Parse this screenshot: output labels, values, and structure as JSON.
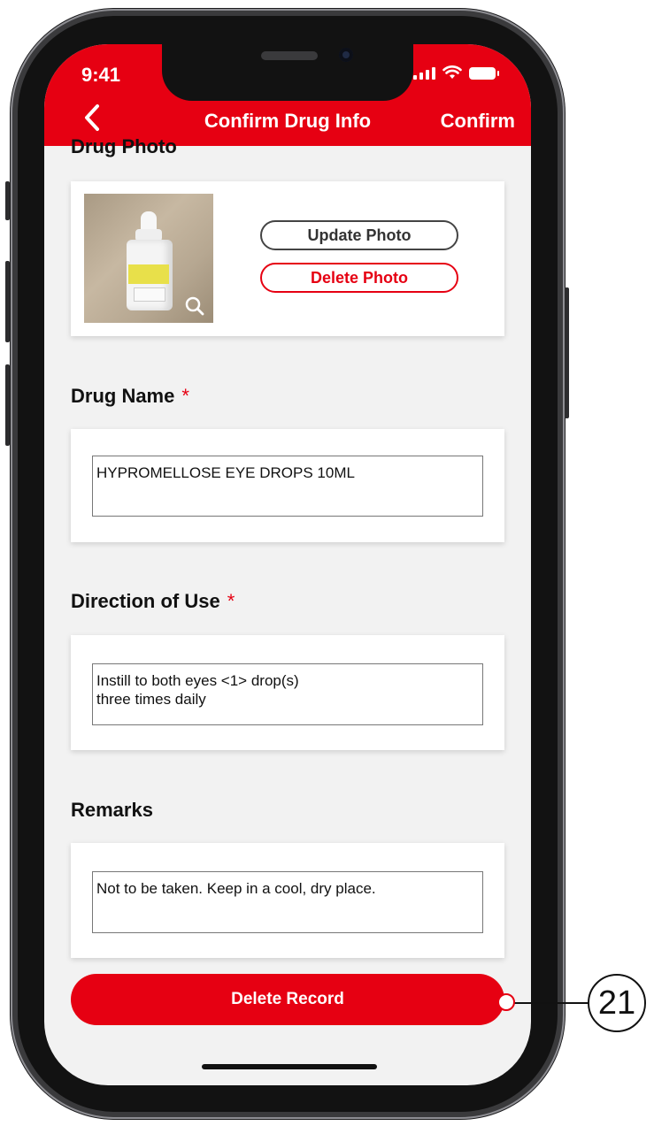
{
  "status_bar": {
    "time": "9:41"
  },
  "nav": {
    "title": "Confirm Drug Info",
    "confirm_label": "Confirm",
    "back_icon": "chevron-left-icon"
  },
  "drug_photo": {
    "section_title": "Drug Photo",
    "update_label": "Update Photo",
    "delete_label": "Delete Photo",
    "zoom_icon": "search-icon"
  },
  "drug_name": {
    "label": "Drug Name",
    "required_mark": "*",
    "value": "HYPROMELLOSE EYE DROPS 10ML"
  },
  "direction_of_use": {
    "label": "Direction of Use",
    "required_mark": "*",
    "value_line1": "Instill to both eyes <1> drop(s)",
    "value_line2": "three times daily"
  },
  "remarks": {
    "label": "Remarks",
    "value": "Not to be taken. Keep in a cool, dry place."
  },
  "actions": {
    "delete_record_label": "Delete Record"
  },
  "annotation": {
    "callout_number": "21"
  },
  "colors": {
    "brand_red": "#e60012",
    "background": "#f2f2f2"
  }
}
